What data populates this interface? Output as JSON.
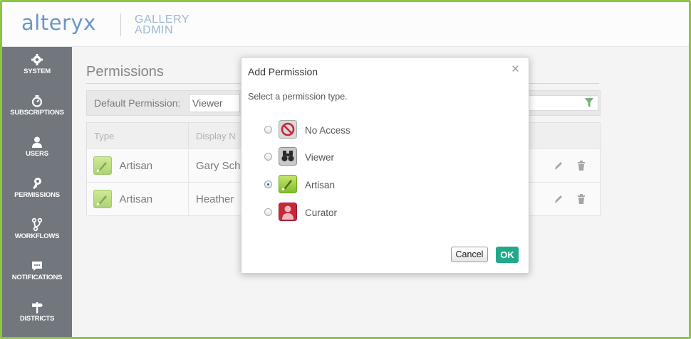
{
  "header": {
    "logo": "alteryx",
    "subtitle_line1": "GALLERY",
    "subtitle_line2": "ADMIN"
  },
  "sidebar": {
    "items": [
      {
        "label": "SYSTEM",
        "icon": "gear-icon"
      },
      {
        "label": "SUBSCRIPTIONS",
        "icon": "stopwatch-icon"
      },
      {
        "label": "USERS",
        "icon": "user-icon"
      },
      {
        "label": "PERMISSIONS",
        "icon": "key-icon",
        "active": true
      },
      {
        "label": "WORKFLOWS",
        "icon": "branch-icon"
      },
      {
        "label": "NOTIFICATIONS",
        "icon": "chat-icon"
      },
      {
        "label": "DISTRICTS",
        "icon": "signpost-icon"
      }
    ]
  },
  "main": {
    "title": "Permissions",
    "default_permission_label": "Default Permission:",
    "default_permission_value": "Viewer",
    "table": {
      "columns": [
        "Type",
        "Display N"
      ],
      "rows": [
        {
          "type": "Artisan",
          "name": "Gary Sch"
        },
        {
          "type": "Artisan",
          "name": "Heather"
        }
      ]
    }
  },
  "modal": {
    "title": "Add Permission",
    "close": "×",
    "subtitle": "Select a permission type.",
    "options": [
      {
        "label": "No Access",
        "icon": "no-access-icon",
        "selected": false
      },
      {
        "label": "Viewer",
        "icon": "binoculars-icon",
        "selected": false
      },
      {
        "label": "Artisan",
        "icon": "paintbrush-icon",
        "selected": true
      },
      {
        "label": "Curator",
        "icon": "curator-person-icon",
        "selected": false
      }
    ],
    "cancel_label": "Cancel",
    "ok_label": "OK"
  },
  "colors": {
    "brand_blue": "#1f5fa3",
    "sidebar_bg": "#262e38",
    "frame_green": "#8cc63f",
    "ok_teal": "#22a88a",
    "artisan_green": "#8cc63f",
    "curator_red": "#c6283a"
  }
}
